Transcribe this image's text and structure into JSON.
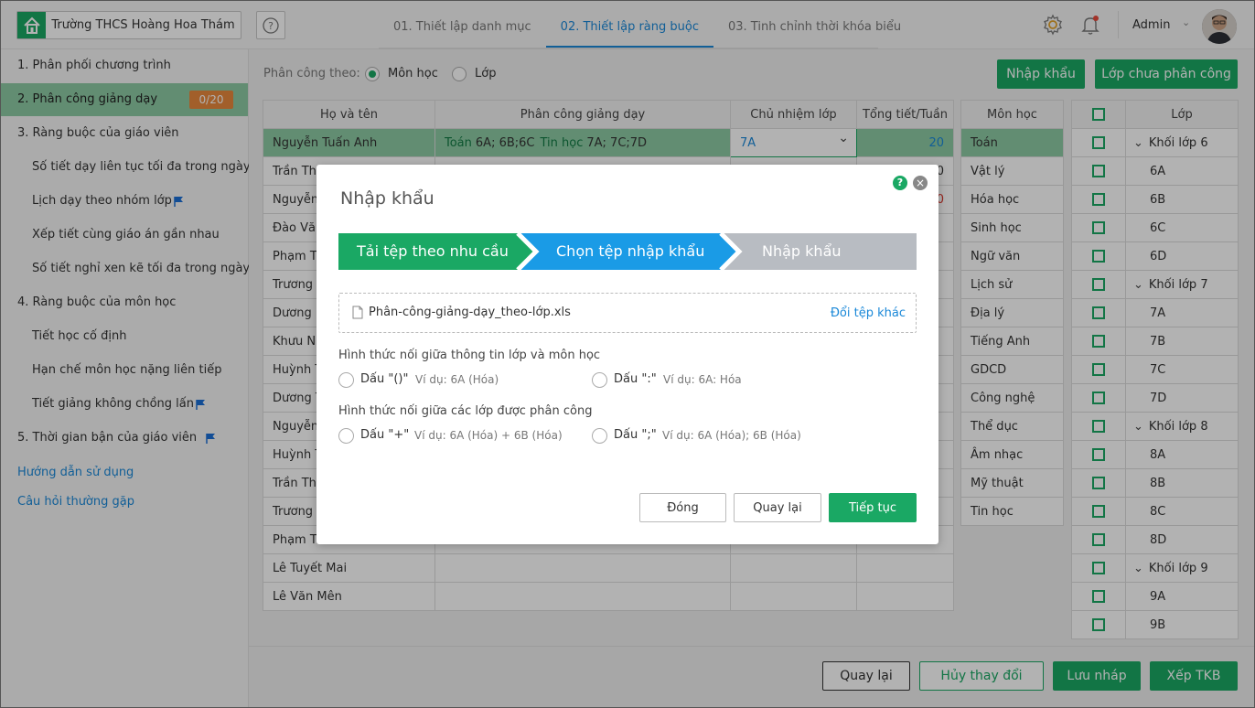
{
  "header": {
    "school_name": "Trường THCS Hoàng Hoa Thám",
    "tabs": [
      {
        "label": "01. Thiết lập danh mục"
      },
      {
        "label": "02. Thiết lập ràng buộc"
      },
      {
        "label": "03. Tinh chỉnh thời khóa biểu"
      }
    ],
    "active_tab": 1,
    "user": "Admin",
    "icons": [
      "home-icon",
      "help-icon",
      "settings-icon",
      "bell-icon"
    ]
  },
  "sidebar": {
    "items": [
      {
        "label": "1. Phân phối chương trình"
      },
      {
        "label": "2. Phân công giảng dạy",
        "badge": "0/20"
      },
      {
        "label": "3. Ràng buộc của giáo viên"
      },
      {
        "label": "Số tiết dạy liên tục tối đa trong ngày"
      },
      {
        "label": "Lịch dạy theo nhóm lớp"
      },
      {
        "label": "Xếp tiết cùng giáo án gần nhau"
      },
      {
        "label": "Số tiết nghỉ xen kẽ tối đa trong ngày"
      },
      {
        "label": "4. Ràng buộc của môn học"
      },
      {
        "label": "Tiết học cố định"
      },
      {
        "label": "Hạn chế môn học nặng liên tiếp"
      },
      {
        "label": "Tiết giảng không chồng lấn"
      },
      {
        "label": "5. Thời gian bận của giáo viên"
      }
    ],
    "links": [
      "Hướng dẫn sử dụng",
      "Câu hỏi thường gặp"
    ]
  },
  "toolbar": {
    "assign_by_label": "Phân công theo:",
    "option_subject": "Môn học",
    "option_class": "Lớp",
    "import_button": "Nhập khẩu",
    "unassigned_button": "Lớp chưa phân công"
  },
  "teacher_table": {
    "headers": [
      "Họ và tên",
      "Phân công giảng dạy",
      "Chủ nhiệm lớp",
      "Tổng tiết/Tuần"
    ],
    "rows": [
      {
        "name": "Nguyễn Tuấn Anh",
        "subj1": "Toán",
        "classes1": "6A; 6B;6C",
        "subj2": "Tin học",
        "classes2": "7A; 7C;7D",
        "homeroom": "7A",
        "total": "20"
      },
      {
        "name": "Trần Tha",
        "total": "0"
      },
      {
        "name": "Nguyễn",
        "total": "0"
      },
      {
        "name": "Đào Văn"
      },
      {
        "name": "Phạm Th"
      },
      {
        "name": "Trương"
      },
      {
        "name": "Dương H"
      },
      {
        "name": "Khưu N"
      },
      {
        "name": "Huỳnh T"
      },
      {
        "name": "Dương T"
      },
      {
        "name": "Nguyễn"
      },
      {
        "name": "Huỳnh T"
      },
      {
        "name": "Trần Thi"
      },
      {
        "name": "Trương"
      },
      {
        "name": "Phạm T"
      },
      {
        "name": "Lê Tuyết Mai"
      },
      {
        "name": "Lê Văn Mên"
      }
    ]
  },
  "subject_table": {
    "header": "Môn học",
    "rows": [
      "Toán",
      "Vật lý",
      "Hóa học",
      "Sinh học",
      "Ngữ văn",
      "Lịch sử",
      "Địa lý",
      "Tiếng Anh",
      "GDCD",
      "Công nghệ",
      "Thể dục",
      "Âm nhạc",
      "Mỹ thuật",
      "Tin học"
    ]
  },
  "class_table": {
    "header": "Lớp",
    "rows": [
      {
        "label": "Khối lớp 6",
        "group": true
      },
      {
        "label": "6A"
      },
      {
        "label": "6B"
      },
      {
        "label": "6C"
      },
      {
        "label": "6D"
      },
      {
        "label": "Khối lớp 7",
        "group": true
      },
      {
        "label": "7A"
      },
      {
        "label": "7B"
      },
      {
        "label": "7C"
      },
      {
        "label": "7D"
      },
      {
        "label": "Khối lớp 8",
        "group": true
      },
      {
        "label": "8A"
      },
      {
        "label": "8B"
      },
      {
        "label": "8C"
      },
      {
        "label": "8D"
      },
      {
        "label": "Khối lớp 9",
        "group": true
      },
      {
        "label": "9A"
      },
      {
        "label": "9B"
      }
    ]
  },
  "bottom": {
    "back": "Quay lại",
    "cancel_changes": "Hủy thay đổi",
    "save_draft": "Lưu nháp",
    "schedule": "Xếp TKB"
  },
  "modal": {
    "title": "Nhập khẩu",
    "steps": [
      "Tải tệp theo nhu cầu",
      "Chọn tệp nhập khẩu",
      "Nhập khẩu"
    ],
    "step_colors": [
      "#1aa864",
      "#1a9be6",
      "#b8bcc2"
    ],
    "file_name": "Phân-công-giảng-dạy_theo-lớp.xls",
    "change_file": "Đổi tệp khác",
    "q1": "Hình thức nối giữa thông tin lớp và môn học",
    "q1_opt1": "Dấu \"()\"",
    "q1_ex1": "Ví dụ: 6A (Hóa)",
    "q1_opt2": "Dấu \":\"",
    "q1_ex2": "Ví dụ: 6A: Hóa",
    "q2": "Hình thức nối giữa các lớp được phân công",
    "q2_opt1": "Dấu \"+\"",
    "q2_ex1": "Ví dụ: 6A (Hóa) + 6B (Hóa)",
    "q2_opt2": "Dấu \";\"",
    "q2_ex2": "Ví dụ: 6A (Hóa); 6B (Hóa)",
    "close": "Đóng",
    "back": "Quay lại",
    "next": "Tiếp tục"
  }
}
